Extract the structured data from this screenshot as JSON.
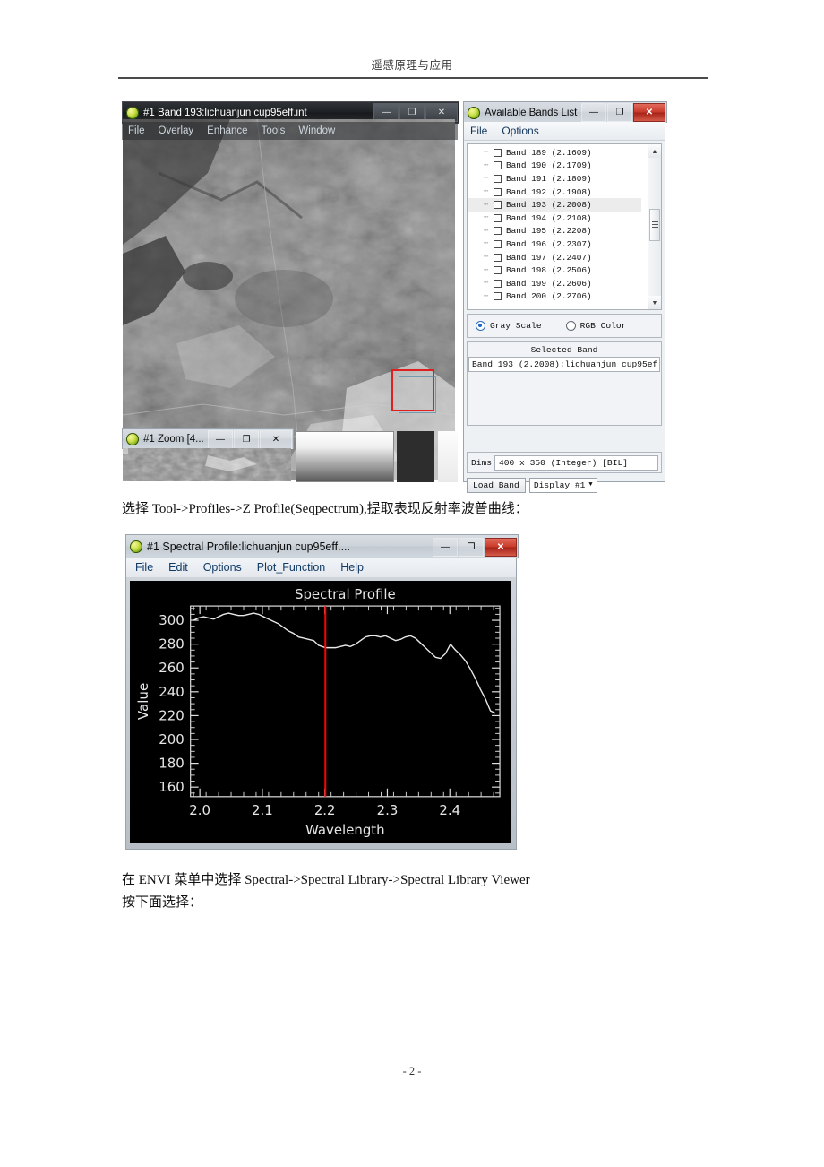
{
  "page": {
    "header": "遥感原理与应用",
    "footer": "- 2 -"
  },
  "display_window": {
    "title": "#1 Band 193:lichuanjun cup95eff.int",
    "menu": [
      "File",
      "Overlay",
      "Enhance",
      "Tools",
      "Window"
    ],
    "buttons": {
      "minimize": "—",
      "maximize": "❐",
      "close": "✕"
    }
  },
  "zoom_window": {
    "title": "#1 Zoom [4...",
    "buttons": {
      "minimize": "—",
      "maximize": "❐",
      "close": "✕"
    }
  },
  "bands_window": {
    "title": "Available Bands List",
    "menu": [
      "File",
      "Options"
    ],
    "buttons": {
      "minimize": "—",
      "maximize": "❐",
      "close": "✕"
    },
    "scroll": {
      "up": "▲",
      "down": "▼"
    },
    "bands": [
      {
        "label": "Band 189  (2.1609)",
        "selected": false
      },
      {
        "label": "Band 190  (2.1709)",
        "selected": false
      },
      {
        "label": "Band 191  (2.1809)",
        "selected": false
      },
      {
        "label": "Band 192  (2.1908)",
        "selected": false
      },
      {
        "label": "Band 193  (2.2008)",
        "selected": true
      },
      {
        "label": "Band 194  (2.2108)",
        "selected": false
      },
      {
        "label": "Band 195  (2.2208)",
        "selected": false
      },
      {
        "label": "Band 196  (2.2307)",
        "selected": false
      },
      {
        "label": "Band 197  (2.2407)",
        "selected": false
      },
      {
        "label": "Band 198  (2.2506)",
        "selected": false
      },
      {
        "label": "Band 199  (2.2606)",
        "selected": false
      },
      {
        "label": "Band 200  (2.2706)",
        "selected": false
      }
    ],
    "gray_scale_label": "Gray Scale",
    "rgb_color_label": "RGB Color",
    "selected_band_title": "Selected Band",
    "selected_band_value": "Band 193  (2.2008):lichuanjun cup95ef",
    "dims_label": "Dims",
    "dims_value": "400 x 350  (Integer) [BIL]",
    "load_band_label": "Load Band",
    "display_combo_value": "Display #1",
    "display_combo_caret": "▼"
  },
  "paragraph_1": "选择 Tool->Profiles->Z Profile(Seqpectrum),提取表现反射率波普曲线：",
  "paragraph_2_line1": "在 ENVI 菜单中选择 Spectral->Spectral Library->Spectral Library Viewer",
  "paragraph_2_line2": "按下面选择：",
  "spectral_window": {
    "title": "#1 Spectral Profile:lichuanjun cup95eff....",
    "menu": [
      "File",
      "Edit",
      "Options",
      "Plot_Function",
      "Help"
    ],
    "buttons": {
      "minimize": "—",
      "maximize": "❐",
      "close": "✕"
    }
  },
  "chart_data": {
    "type": "line",
    "title": "Spectral Profile",
    "xlabel": "Wavelength",
    "ylabel": "Value",
    "xlim": [
      1.985,
      2.48
    ],
    "ylim": [
      152,
      312
    ],
    "xticks": [
      "2.0",
      "2.1",
      "2.2",
      "2.3",
      "2.4"
    ],
    "xtick_values": [
      2.0,
      2.1,
      2.2,
      2.3,
      2.4
    ],
    "yticks": [
      "160",
      "180",
      "200",
      "220",
      "240",
      "260",
      "280",
      "300"
    ],
    "ytick_values": [
      160,
      180,
      200,
      220,
      240,
      260,
      280,
      300
    ],
    "grid": false,
    "legend": "none",
    "line_color": "#e8e8e8",
    "cursor_color": "#ff0000",
    "cursor_x": 2.2008,
    "background": "#000000",
    "series": [
      {
        "name": "Spectral Profile",
        "x": [
          1.99,
          1.998,
          2.006,
          2.014,
          2.022,
          2.03,
          2.038,
          2.046,
          2.054,
          2.062,
          2.07,
          2.078,
          2.086,
          2.094,
          2.102,
          2.11,
          2.118,
          2.126,
          2.134,
          2.142,
          2.15,
          2.158,
          2.166,
          2.174,
          2.182,
          2.19,
          2.201,
          2.209,
          2.217,
          2.225,
          2.233,
          2.241,
          2.249,
          2.257,
          2.265,
          2.273,
          2.281,
          2.289,
          2.297,
          2.305,
          2.313,
          2.321,
          2.329,
          2.337,
          2.345,
          2.353,
          2.361,
          2.369,
          2.377,
          2.385,
          2.393,
          2.401,
          2.409,
          2.417,
          2.425,
          2.433,
          2.441,
          2.449,
          2.457,
          2.465,
          2.473
        ],
        "y": [
          300,
          302,
          303,
          302,
          301,
          303,
          305,
          306,
          305,
          304,
          304,
          305,
          306,
          305,
          303,
          301,
          299,
          297,
          294,
          291,
          289,
          286,
          285,
          284,
          283,
          279,
          277,
          277,
          277,
          278,
          279,
          278,
          280,
          283,
          286,
          287,
          287,
          286,
          287,
          285,
          283,
          284,
          286,
          287,
          285,
          281,
          277,
          273,
          269,
          268,
          272,
          280,
          275,
          271,
          266,
          259,
          251,
          242,
          234,
          224,
          222
        ]
      }
    ]
  }
}
